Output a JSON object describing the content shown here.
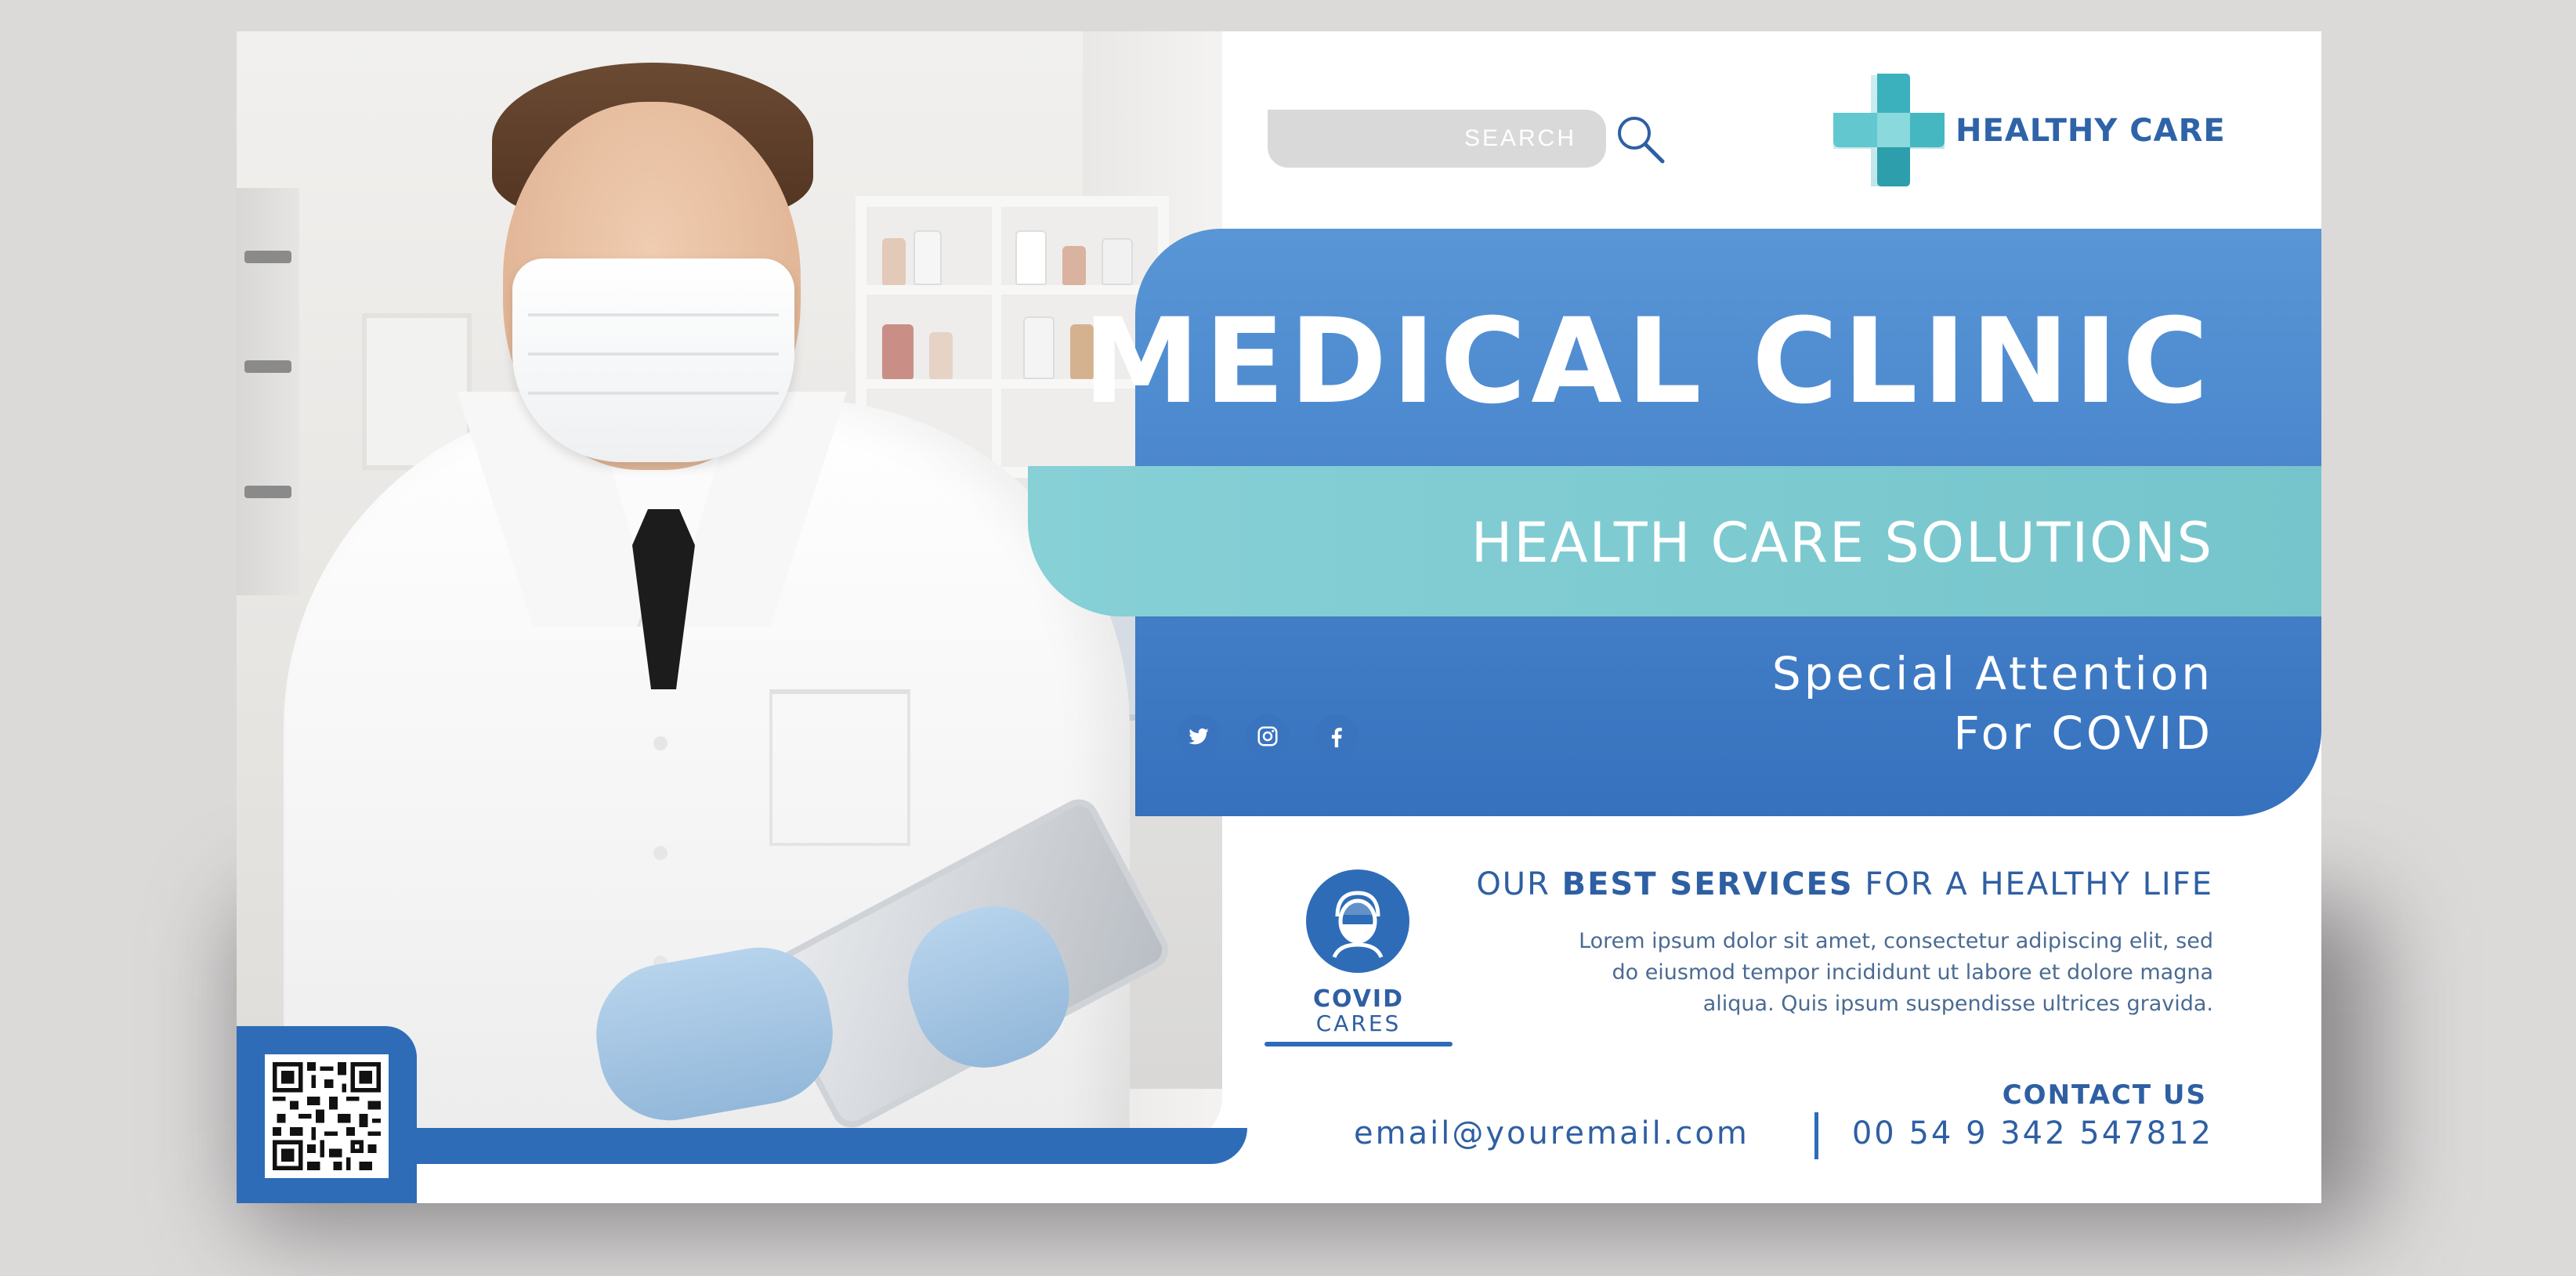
{
  "search": {
    "placeholder": "SEARCH"
  },
  "brand": {
    "name": "HEALTHY CARE"
  },
  "hero": {
    "title": "MEDICAL CLINIC",
    "subtitle": "HEALTH CARE SOLUTIONS",
    "tagline_line1": "Special Attention",
    "tagline_line2": "For COVID"
  },
  "social": [
    {
      "icon": "twitter-icon"
    },
    {
      "icon": "instagram-icon"
    },
    {
      "icon": "facebook-icon"
    }
  ],
  "covid": {
    "title": "COVID",
    "subtitle": "CARES",
    "icon": "masked-person-icon"
  },
  "services": {
    "heading_prefix": "OUR ",
    "heading_bold": "BEST SERVICES",
    "heading_suffix": " FOR A HEALTHY LIFE",
    "body_line1": "Lorem ipsum dolor sit amet, consectetur adipiscing elit, sed",
    "body_line2": "do eiusmod tempor incididunt ut labore et dolore magna",
    "body_line3": "aliqua. Quis ipsum suspendisse ultrices gravida."
  },
  "contact": {
    "label": "CONTACT US",
    "email": "email@youremail.com",
    "phone": "00 54 9 342 547812"
  },
  "colors": {
    "primary_blue": "#2e6cb8",
    "light_blue": "#5896d6",
    "teal": "#7ecbd1",
    "text_blue": "#2e5fa3",
    "background": "#dcd9d9"
  },
  "qr": {
    "icon": "qr-code-icon"
  }
}
